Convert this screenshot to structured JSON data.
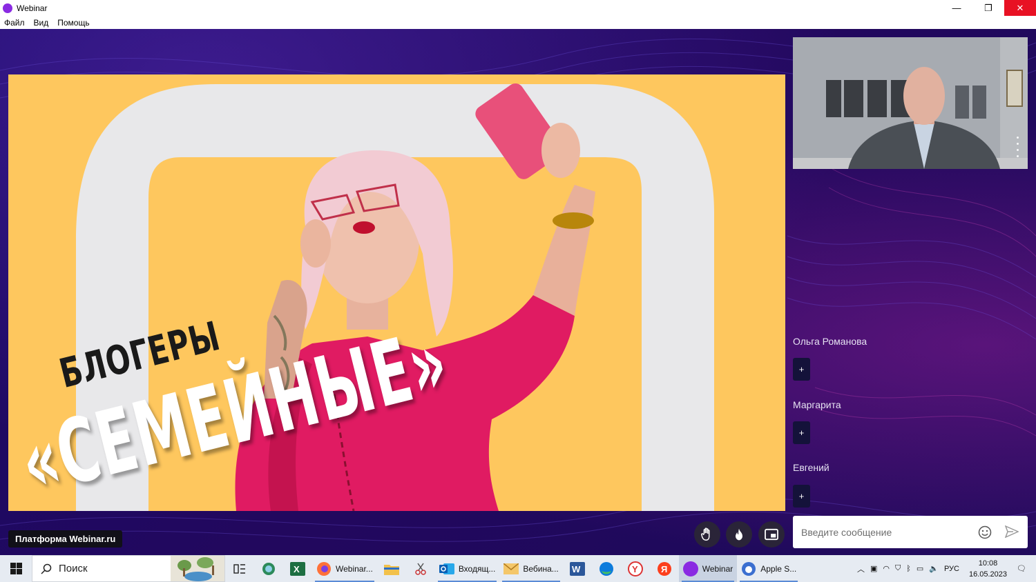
{
  "window": {
    "title": "Webinar",
    "menu": [
      "Файл",
      "Вид",
      "Помощь"
    ],
    "controls": {
      "minimize": "—",
      "maximize": "❐",
      "close": "✕"
    }
  },
  "slide": {
    "title_small": "БЛОГЕРЫ",
    "title_big": "«СЕМЕЙНЫЕ»"
  },
  "participants": [
    {
      "name": "Ольга Романова",
      "add": "+"
    },
    {
      "name": "Маргарита",
      "add": "+"
    },
    {
      "name": "Евгений",
      "add": "+"
    }
  ],
  "footer": {
    "platform_label": "Платформа Webinar.ru",
    "controls": [
      "raise-hand-icon",
      "fire-icon",
      "picture-in-picture-icon"
    ]
  },
  "chat": {
    "placeholder": "Введите сообщение"
  },
  "taskbar": {
    "search_placeholder": "Поиск",
    "apps": [
      {
        "label": "Webinar...",
        "icon": "firefox-icon"
      },
      {
        "label": "Входящ...",
        "icon": "outlook-icon"
      },
      {
        "label": "Вебина...",
        "icon": "mail-icon"
      },
      {
        "label": "Webinar",
        "icon": "webinar-icon",
        "active": true
      },
      {
        "label": "Apple S...",
        "icon": "apple-icon"
      }
    ],
    "language": "РУС",
    "time": "10:08",
    "date": "16.05.2023"
  },
  "colors": {
    "accent_purple": "#8a2be2",
    "background": "#1e0a5c",
    "slide_yellow": "#fec75e",
    "sweater_pink": "#e01b62"
  }
}
